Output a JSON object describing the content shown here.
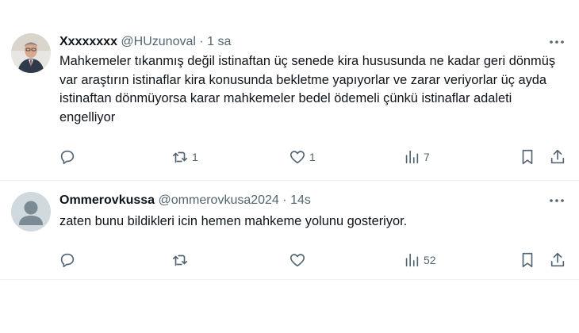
{
  "tweets": [
    {
      "display_name": "Xxxxxxxx",
      "handle": "@HUzunoval",
      "separator": "·",
      "time": "1 sa",
      "text": "Mahkemeler tıkanmış değil istinaftan üç senede kira hususunda ne kadar geri dönmüş var araştırın istinaflar kira konusunda bekletme yapıyorlar ve zarar veriyorlar üç ayda istinaftan dönmüyorsa karar mahkemeler bedel ödemeli çünkü istinaflar adaleti engelliyor",
      "actions": {
        "replies": "",
        "retweets": "1",
        "likes": "1",
        "views": "7"
      },
      "avatar_icon": "profile-photo"
    },
    {
      "display_name": "Ommerovkussa",
      "handle": "@ommerovkusa2024",
      "separator": "·",
      "time": "14s",
      "text": "zaten bunu bildikleri icin hemen mahkeme yolunu gosteriyor.",
      "actions": {
        "replies": "",
        "retweets": "",
        "likes": "",
        "views": "52"
      },
      "avatar_icon": "default-profile-icon"
    }
  ],
  "colors": {
    "text": "#0f1419",
    "secondary": "#536471",
    "divider": "#eff3f4",
    "default_avatar": "#cfd9de"
  }
}
